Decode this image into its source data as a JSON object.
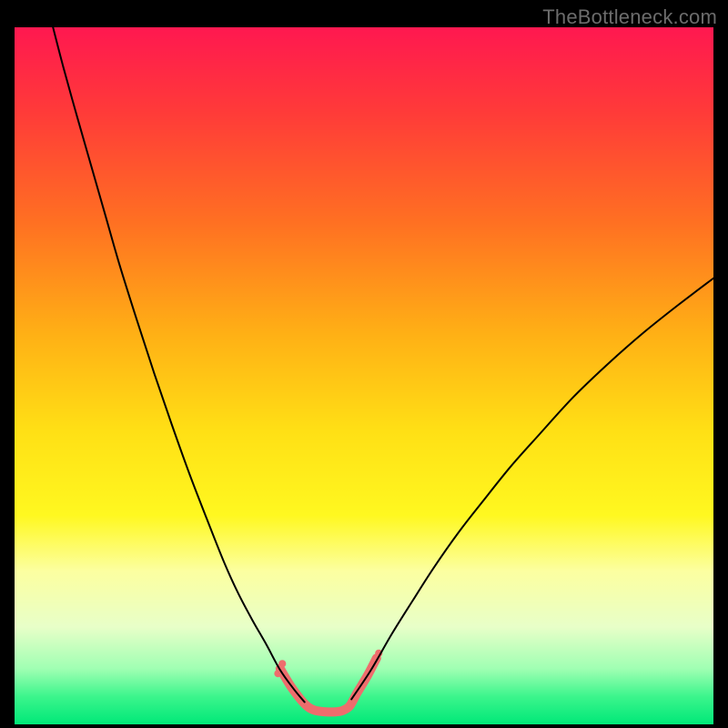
{
  "watermark": "TheBottleneck.com",
  "chart_data": {
    "type": "line",
    "title": "",
    "xlabel": "",
    "ylabel": "",
    "xlim": [
      0,
      1
    ],
    "ylim": [
      0,
      1
    ],
    "background_gradient": {
      "direction": "vertical",
      "stops": [
        {
          "pos": 0.0,
          "color": "#ff1850"
        },
        {
          "pos": 0.12,
          "color": "#ff3a39"
        },
        {
          "pos": 0.28,
          "color": "#ff7022"
        },
        {
          "pos": 0.44,
          "color": "#ffb015"
        },
        {
          "pos": 0.58,
          "color": "#ffe015"
        },
        {
          "pos": 0.7,
          "color": "#fff820"
        },
        {
          "pos": 0.78,
          "color": "#fcffa0"
        },
        {
          "pos": 0.86,
          "color": "#e8ffc8"
        },
        {
          "pos": 0.92,
          "color": "#a0ffb3"
        },
        {
          "pos": 0.96,
          "color": "#3cf58c"
        },
        {
          "pos": 1.0,
          "color": "#00e878"
        }
      ]
    },
    "series": [
      {
        "name": "curve-left",
        "color": "#000000",
        "stroke_width": 2,
        "points": [
          {
            "x": 0.055,
            "y": 1.0
          },
          {
            "x": 0.07,
            "y": 0.942
          },
          {
            "x": 0.09,
            "y": 0.87
          },
          {
            "x": 0.11,
            "y": 0.8
          },
          {
            "x": 0.13,
            "y": 0.73
          },
          {
            "x": 0.15,
            "y": 0.66
          },
          {
            "x": 0.175,
            "y": 0.58
          },
          {
            "x": 0.2,
            "y": 0.503
          },
          {
            "x": 0.225,
            "y": 0.43
          },
          {
            "x": 0.25,
            "y": 0.36
          },
          {
            "x": 0.275,
            "y": 0.295
          },
          {
            "x": 0.3,
            "y": 0.232
          },
          {
            "x": 0.32,
            "y": 0.188
          },
          {
            "x": 0.34,
            "y": 0.15
          },
          {
            "x": 0.36,
            "y": 0.115
          },
          {
            "x": 0.38,
            "y": 0.078
          },
          {
            "x": 0.4,
            "y": 0.05
          },
          {
            "x": 0.415,
            "y": 0.032
          }
        ]
      },
      {
        "name": "valley-highlight",
        "color": "#ee6d6d",
        "stroke_width": 10,
        "points": [
          {
            "x": 0.38,
            "y": 0.08
          },
          {
            "x": 0.395,
            "y": 0.055
          },
          {
            "x": 0.41,
            "y": 0.035
          },
          {
            "x": 0.42,
            "y": 0.025
          },
          {
            "x": 0.43,
            "y": 0.02
          },
          {
            "x": 0.445,
            "y": 0.018
          },
          {
            "x": 0.46,
            "y": 0.018
          },
          {
            "x": 0.47,
            "y": 0.02
          },
          {
            "x": 0.48,
            "y": 0.027
          },
          {
            "x": 0.49,
            "y": 0.045
          },
          {
            "x": 0.505,
            "y": 0.07
          },
          {
            "x": 0.518,
            "y": 0.095
          }
        ]
      },
      {
        "name": "curve-right",
        "color": "#000000",
        "stroke_width": 2,
        "points": [
          {
            "x": 0.482,
            "y": 0.036
          },
          {
            "x": 0.51,
            "y": 0.078
          },
          {
            "x": 0.54,
            "y": 0.13
          },
          {
            "x": 0.57,
            "y": 0.178
          },
          {
            "x": 0.6,
            "y": 0.225
          },
          {
            "x": 0.635,
            "y": 0.275
          },
          {
            "x": 0.67,
            "y": 0.32
          },
          {
            "x": 0.71,
            "y": 0.37
          },
          {
            "x": 0.75,
            "y": 0.415
          },
          {
            "x": 0.8,
            "y": 0.47
          },
          {
            "x": 0.85,
            "y": 0.518
          },
          {
            "x": 0.9,
            "y": 0.562
          },
          {
            "x": 0.95,
            "y": 0.602
          },
          {
            "x": 1.0,
            "y": 0.64
          }
        ]
      }
    ]
  }
}
